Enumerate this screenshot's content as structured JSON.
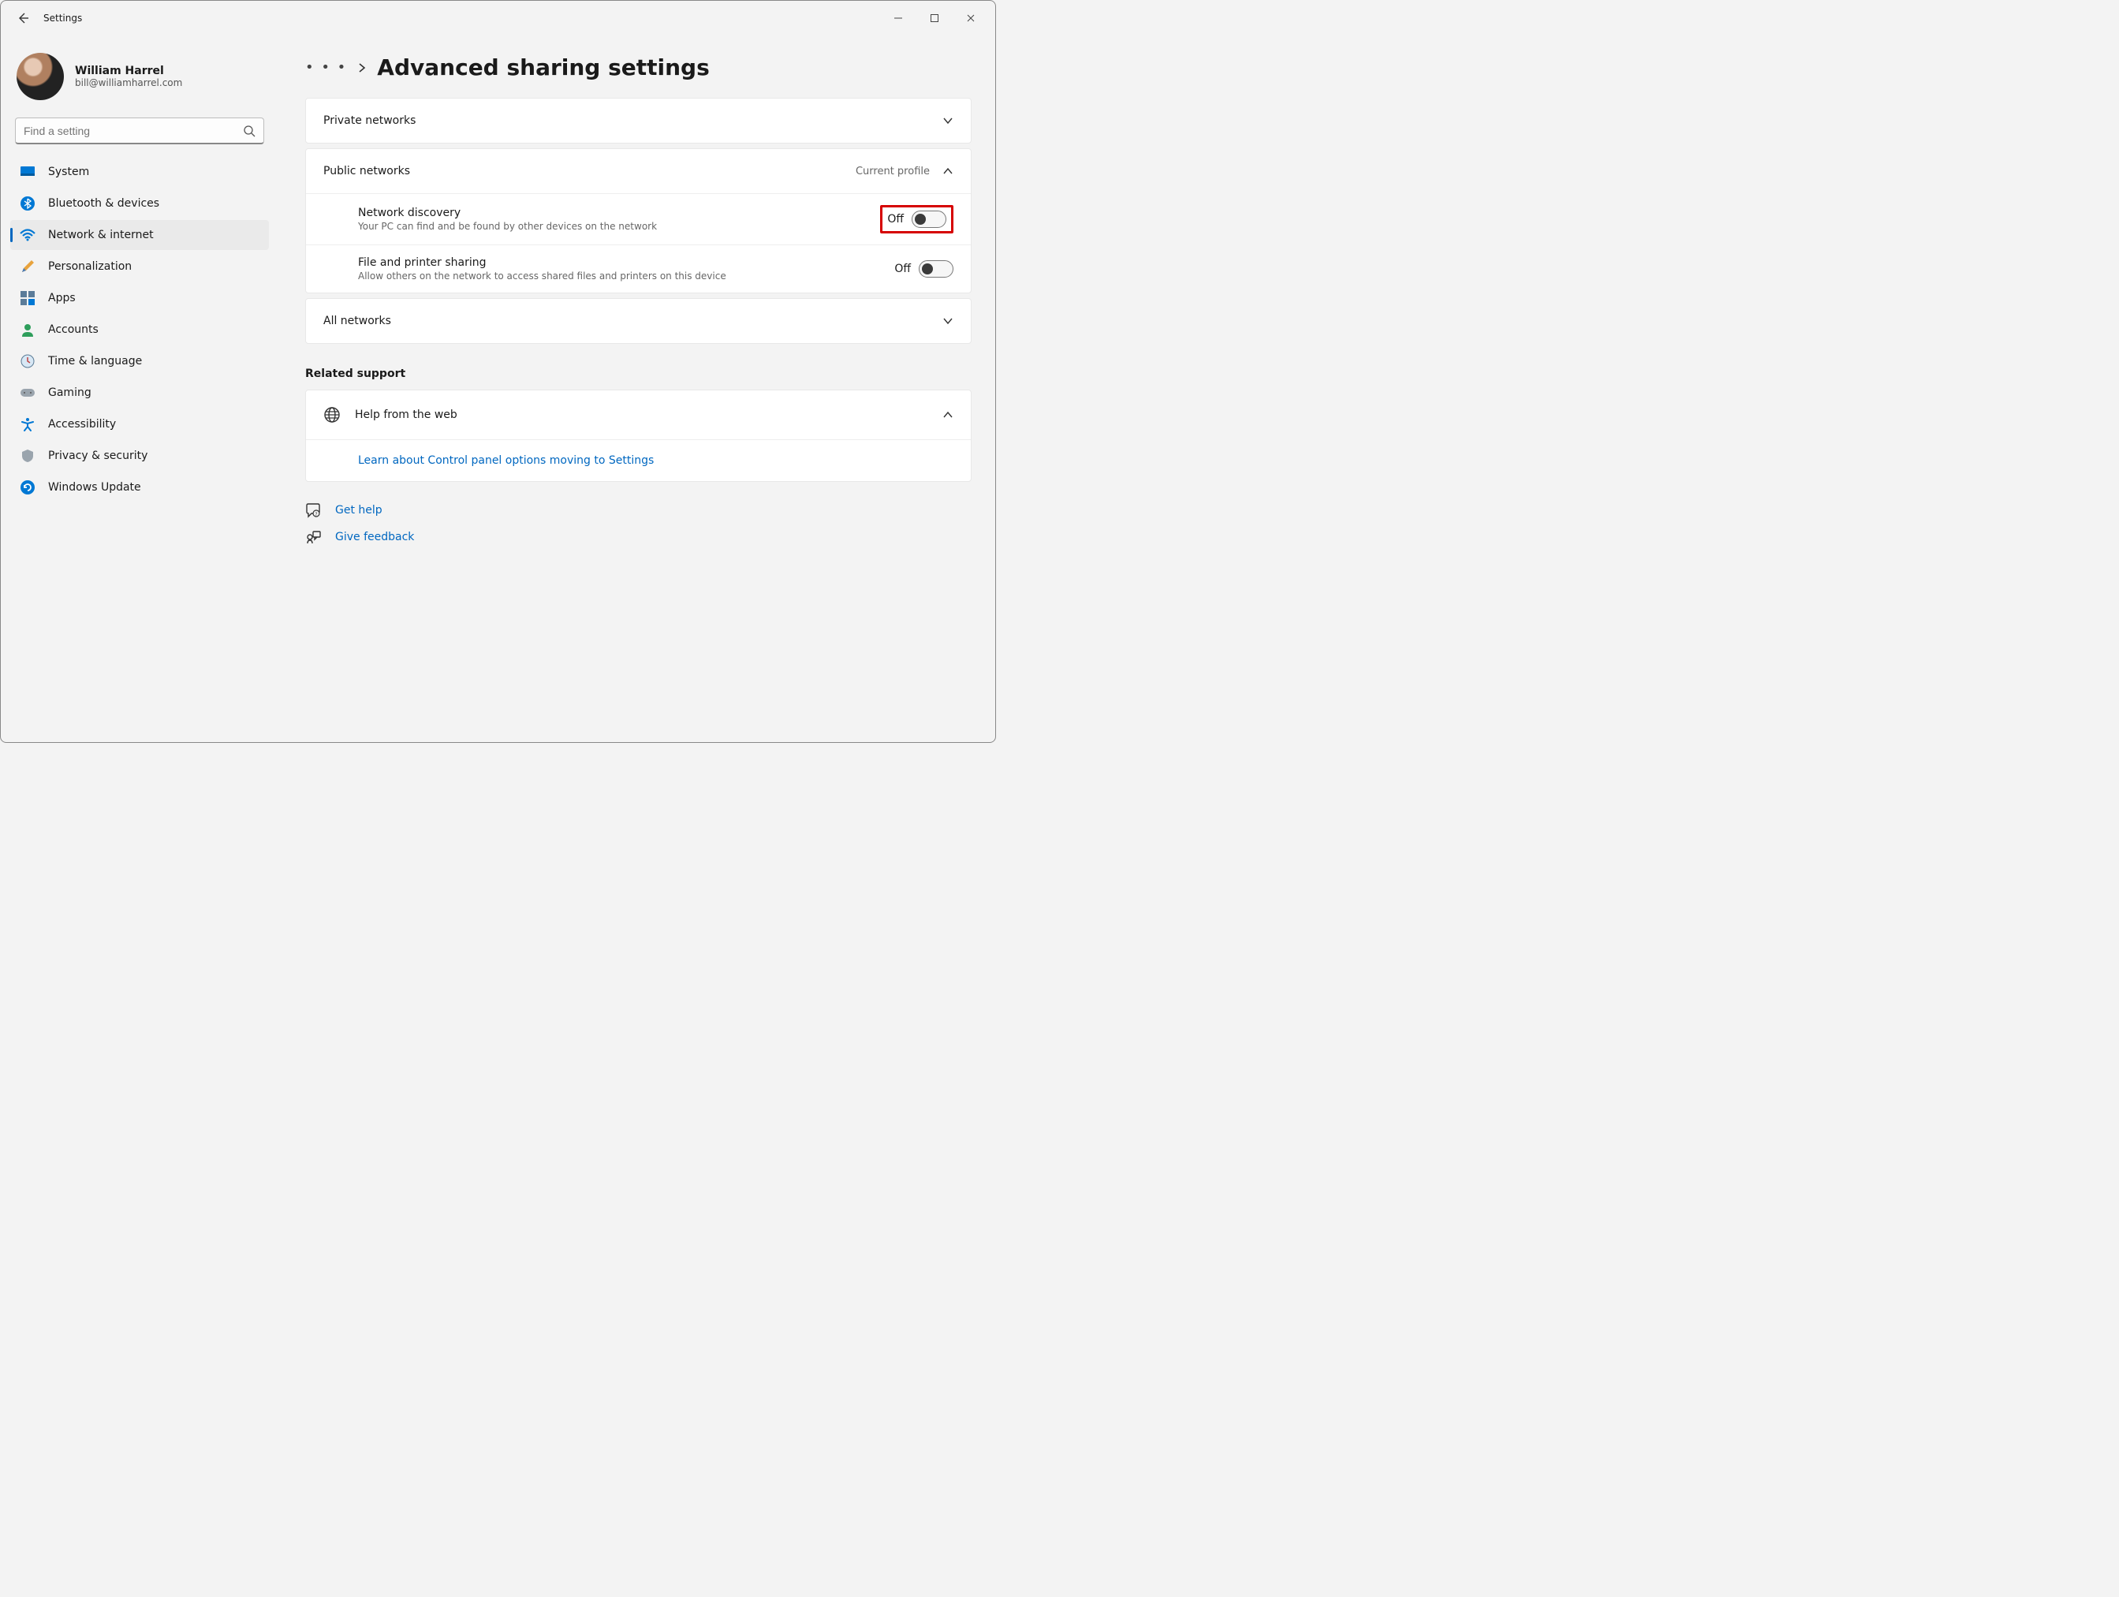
{
  "window": {
    "title": "Settings"
  },
  "user": {
    "name": "William Harrel",
    "email": "bill@williamharrel.com"
  },
  "search": {
    "placeholder": "Find a setting"
  },
  "nav": {
    "items": [
      {
        "label": "System"
      },
      {
        "label": "Bluetooth & devices"
      },
      {
        "label": "Network & internet"
      },
      {
        "label": "Personalization"
      },
      {
        "label": "Apps"
      },
      {
        "label": "Accounts"
      },
      {
        "label": "Time & language"
      },
      {
        "label": "Gaming"
      },
      {
        "label": "Accessibility"
      },
      {
        "label": "Privacy & security"
      },
      {
        "label": "Windows Update"
      }
    ],
    "activeIndex": 2
  },
  "page": {
    "title": "Advanced sharing settings",
    "panels": {
      "private": {
        "title": "Private networks"
      },
      "public": {
        "title": "Public networks",
        "meta": "Current profile",
        "network_discovery": {
          "title": "Network discovery",
          "desc": "Your PC can find and be found by other devices on the network",
          "state": "Off"
        },
        "file_printer": {
          "title": "File and printer sharing",
          "desc": "Allow others on the network to access shared files and printers on this device",
          "state": "Off"
        }
      },
      "all": {
        "title": "All networks"
      }
    },
    "related": {
      "label": "Related support",
      "help_title": "Help from the web",
      "help_link": "Learn about Control panel options moving to Settings"
    },
    "footer": {
      "get_help": "Get help",
      "feedback": "Give feedback"
    }
  }
}
